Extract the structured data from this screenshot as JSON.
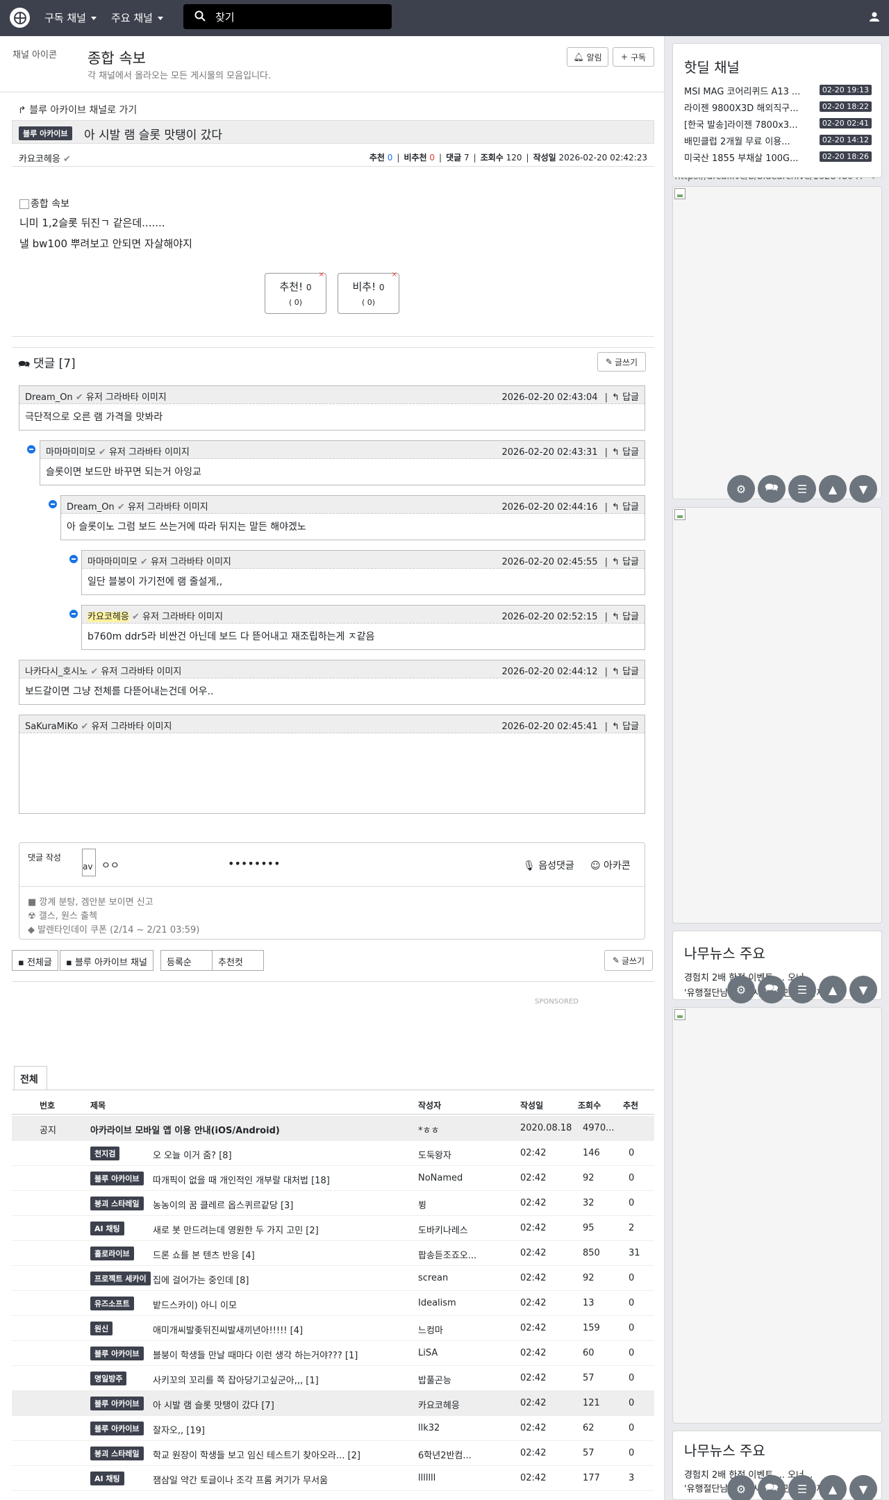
{
  "nav": {
    "menu1": "구독 채널",
    "menu2": "주요 채널",
    "search": "찾기"
  },
  "header": {
    "icon_alt": "채널 아이콘",
    "title": "종합 속보",
    "desc": "각 채널에서 올라오는 모든 게시물의 모음입니다.",
    "alarm": "알림",
    "subscribe": "구독"
  },
  "article": {
    "back": "블루 아카이브 채널로 가기",
    "category": "블루 아카이브",
    "title": "아 시발 램 슬롯 맛탱이 갔다",
    "author": "카요코헤응",
    "rec_label": "추천",
    "rec": "0",
    "nrec_label": "비추천",
    "nrec": "0",
    "cmt_label": "댓글",
    "cmt": "7",
    "view_label": "조회수",
    "view": "120",
    "date_label": "작성일",
    "date": "2026-02-20 02:42:23",
    "url": "https://arca.live/b/bluearchive/162848047",
    "img_alt": "종합 속보",
    "line1": "니미 1,2슬롯 뒤진ㄱ 같은데.......",
    "line2": "낼 bw100 뿌려보고 안되면 자살해야지",
    "vote_up": "추천!",
    "vote_up_n": "0",
    "vote_up_sub": "( 0)",
    "vote_down": "비추!",
    "vote_down_n": "0",
    "vote_down_sub": "( 0)"
  },
  "comments": {
    "header": "댓글 [7]",
    "write": "글쓰기",
    "avatar_alt": "유저 그라바타 이미지",
    "reply": "답글",
    "items": [
      {
        "name": "Dream_On",
        "date": "2026-02-20 02:43:04",
        "text": "극단적으로 오른 램 가격을 맛봐라"
      },
      {
        "name": "마마마미미모",
        "date": "2026-02-20 02:43:31",
        "text": "슬롯이면 보드만 바꾸면 되는거 아잉교"
      },
      {
        "name": "Dream_On",
        "date": "2026-02-20 02:44:16",
        "text": "아 슬롯이노 그럼 보드 쓰는거에 따라 뒤지는 말든 해야겠노"
      },
      {
        "name": "마마마미미모",
        "date": "2026-02-20 02:45:55",
        "text": "일단 블붕이 가기전에 램 줄설게,,"
      },
      {
        "name": "카요코헤응",
        "date": "2026-02-20 02:52:15",
        "text": "b760m ddr5라 비싼건 아닌데 보드 다 뜯어내고 재조립하는게 ㅈ같음"
      },
      {
        "name": "나카다시_호시노",
        "date": "2026-02-20 02:44:12",
        "text": "보드갈이면 그냥 전체를 다뜯어내는건데 어우.."
      },
      {
        "name": "SaKuraMiKo",
        "date": "2026-02-20 02:45:41",
        "text": ""
      }
    ]
  },
  "writebox": {
    "label": "댓글 작성",
    "avatar": "av",
    "nick": "ㅇㅇ",
    "pw": "••••••••",
    "voice": "음성댓글",
    "emoji": "아카콘",
    "notice1": "■ 깡계 분탕, 겜안분 보이면 신고",
    "notice2": "☢ 갤스, 원스 출첵",
    "notice3": "◆ 발렌타인데이 쿠폰 (2/14 ~ 2/21 03:59)"
  },
  "tabs": {
    "all": "전체글",
    "channel": "블루 아카이브 채널",
    "sort": "등록순",
    "best": "추천컷",
    "write": "글쓰기",
    "sponsored": "SPONSORED",
    "board_tab": "전체"
  },
  "table": {
    "headers": [
      "번호",
      "제목",
      "작성자",
      "작성일",
      "조회수",
      "추천"
    ],
    "rows": [
      {
        "no": "공지",
        "cat": "",
        "cat2": "",
        "title": "아카라이브 모바일 앱 이용 안내(iOS/Android)",
        "author": "*ㅎㅎ",
        "date": "2020.08.18",
        "views": "4970...",
        "rec": ""
      },
      {
        "no": "",
        "cat": "천지검",
        "cat2": "",
        "title": "오 오늘 이거 줌? [8]",
        "author": "도둑왕자",
        "date": "02:42",
        "views": "146",
        "rec": "0"
      },
      {
        "no": "",
        "cat": "블루 아카이브",
        "cat2": "",
        "title": "따개픽이 없을 때 개인적인 개부랄 대처법 [18]",
        "author": "NoNamed",
        "date": "02:42",
        "views": "92",
        "rec": "0"
      },
      {
        "no": "",
        "cat": "붕괴 스타레일",
        "cat2": "",
        "title": "농농이의 꿈 클레르 옵스퀴르같당 [3]",
        "author": "뷩",
        "date": "02:42",
        "views": "32",
        "rec": "0"
      },
      {
        "no": "",
        "cat": "AI 채팅",
        "cat2": "일반",
        "title": "새로 봇 만드려는데 영원한 두 가지 고민 [2]",
        "author": "도바키나레스",
        "date": "02:42",
        "views": "95",
        "rec": "2"
      },
      {
        "no": "",
        "cat": "홀로라이브",
        "cat2": "번역",
        "title": "드론 쇼를 본 텐츠 반응 [4]",
        "author": "팝송듣조죠오...",
        "date": "02:42",
        "views": "850",
        "rec": "31"
      },
      {
        "no": "",
        "cat": "프로젝트 세카이",
        "cat2": "",
        "title": "집에 걸어가는 중인데 [8]",
        "author": "screan",
        "date": "02:42",
        "views": "92",
        "rec": "0"
      },
      {
        "no": "",
        "cat": "유즈소프트",
        "cat2": "스포",
        "title": "밭드스카이) 아니 이모",
        "author": "Idealism",
        "date": "02:42",
        "views": "13",
        "rec": "0"
      },
      {
        "no": "",
        "cat": "원신",
        "cat2": "",
        "title": "애미개씨발좆뒤진씨발새끼년아!!!!! [4]",
        "author": "느컹마",
        "date": "02:42",
        "views": "159",
        "rec": "0"
      },
      {
        "no": "",
        "cat": "블루 아카이브",
        "cat2": "",
        "title": "블붕이 학생들 만날 때마다 이런 생각 하는거야??? [1]",
        "author": "LiSA",
        "date": "02:42",
        "views": "60",
        "rec": "0"
      },
      {
        "no": "",
        "cat": "명일방주",
        "cat2": "",
        "title": "사키꼬의 꼬리를 쪽 잡아당기고싶군아,,, [1]",
        "author": "밥풀곤능",
        "date": "02:42",
        "views": "57",
        "rec": "0"
      },
      {
        "no": "",
        "cat": "블루 아카이브",
        "cat2": "",
        "title": "아 시발 램 슬롯 맛탱이 갔다 [7]",
        "author": "카요코헤응",
        "date": "02:42",
        "views": "121",
        "rec": "0"
      },
      {
        "no": "",
        "cat": "블루 아카이브",
        "cat2": "",
        "title": "잘자오,, [19]",
        "author": "llk32",
        "date": "02:42",
        "views": "62",
        "rec": "0"
      },
      {
        "no": "",
        "cat": "붕괴 스타레일",
        "cat2": "",
        "title": "학교 원장이 학생들 보고 임신 테스트기 찾아오라... [2]",
        "author": "6학년2반컴...",
        "date": "02:42",
        "views": "57",
        "rec": "0"
      },
      {
        "no": "",
        "cat": "AI 채팅",
        "cat2": "일반",
        "title": "잼삼일 약간 토글이나 조각 프롬 켜기가 무서움",
        "author": "lllllll",
        "date": "02:42",
        "views": "177",
        "rec": "3"
      }
    ]
  },
  "sidebar": {
    "hotdeal_title": "핫딜 채널",
    "hotdeals": [
      {
        "t": "MSI MAG 코어리퀴드 A13 ...",
        "d": "02-20 19:13"
      },
      {
        "t": "라이젠 9800X3D 해외직구...",
        "d": "02-20 18:22"
      },
      {
        "t": "[한국 발송]라이젠 7800x3...",
        "d": "02-20 02:41"
      },
      {
        "t": "배민클럽 2개월 무료 이용...",
        "d": "02-20 14:12"
      },
      {
        "t": "미국산 1855 부채살 100G...",
        "d": "02-20 18:26"
      }
    ],
    "news_title": "나무뉴스 주요",
    "news1": "경험치 2배 한정 이벤트 ... 오너...",
    "news2": "'유행절단남'과 '창시자'의 만남...화제의 ..."
  },
  "colors": {
    "nav_bg": "#3d414d",
    "accent_blue": "#1a73e8",
    "accent_red": "#e53935"
  }
}
